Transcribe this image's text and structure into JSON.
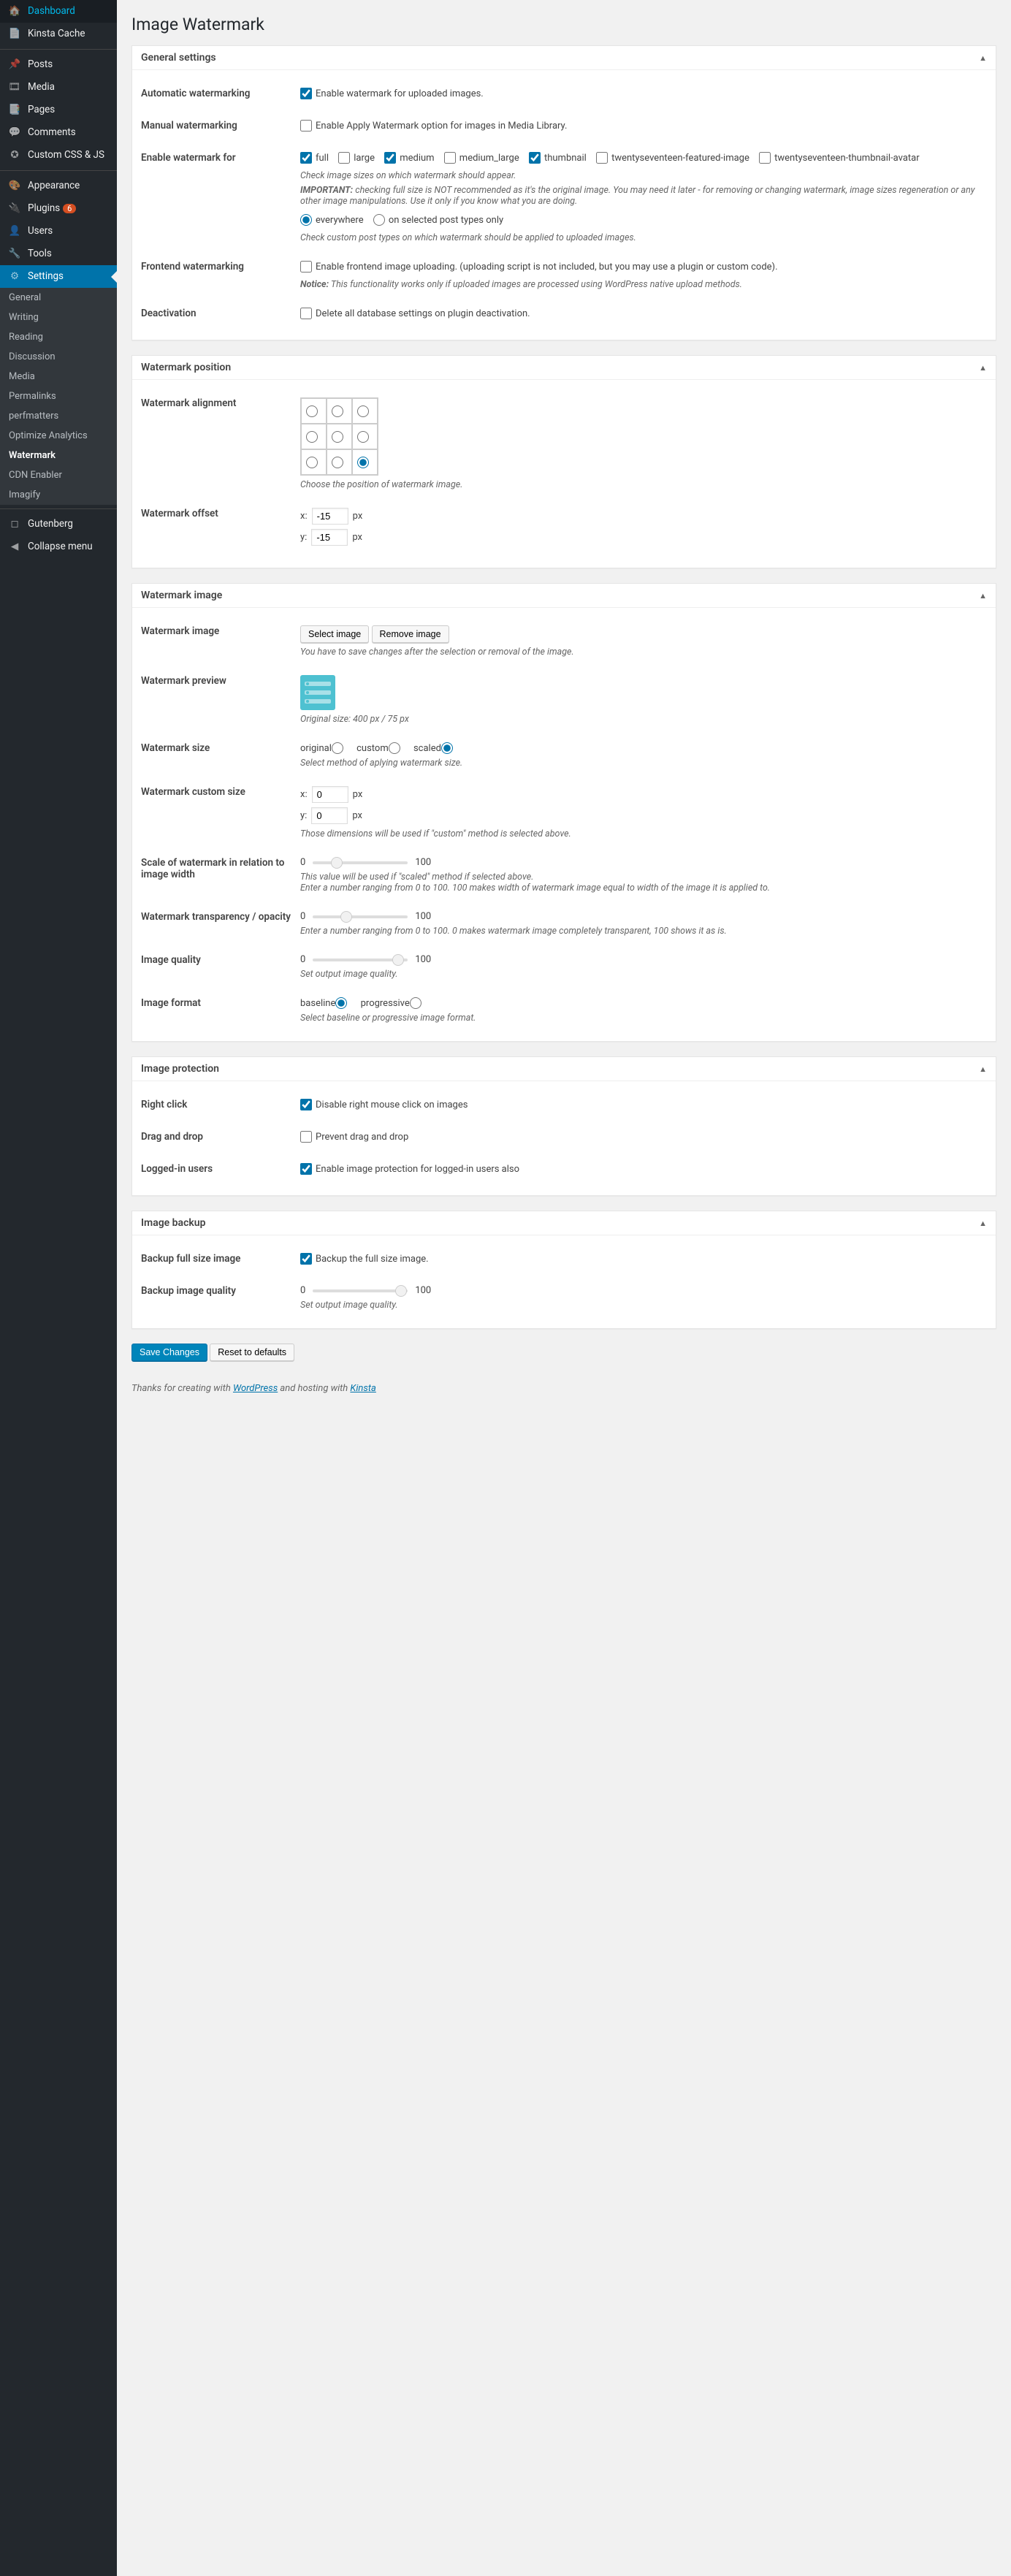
{
  "page_title": "Image Watermark",
  "sidebar": {
    "items": [
      {
        "icon": "🏠",
        "label": "Dashboard"
      },
      {
        "icon": "📄",
        "label": "Kinsta Cache"
      },
      {
        "icon": "📌",
        "label": "Posts"
      },
      {
        "icon": "🎞",
        "label": "Media"
      },
      {
        "icon": "📑",
        "label": "Pages"
      },
      {
        "icon": "💬",
        "label": "Comments"
      },
      {
        "icon": "✪",
        "label": "Custom CSS & JS"
      },
      {
        "icon": "🎨",
        "label": "Appearance"
      },
      {
        "icon": "🔌",
        "label": "Plugins",
        "badge": "6"
      },
      {
        "icon": "👤",
        "label": "Users"
      },
      {
        "icon": "🔧",
        "label": "Tools"
      },
      {
        "icon": "⚙",
        "label": "Settings",
        "active": true
      }
    ],
    "sub": [
      "General",
      "Writing",
      "Reading",
      "Discussion",
      "Media",
      "Permalinks",
      "perfmatters",
      "Optimize Analytics",
      "Watermark",
      "CDN Enabler",
      "Imagify"
    ],
    "sub_active": "Watermark",
    "tail": [
      {
        "icon": "◻",
        "label": "Gutenberg"
      },
      {
        "icon": "◀",
        "label": "Collapse menu"
      }
    ]
  },
  "general": {
    "heading": "General settings",
    "auto": {
      "label": "Automatic watermarking",
      "text": "Enable watermark for uploaded images."
    },
    "manual": {
      "label": "Manual watermarking",
      "text": "Enable Apply Watermark option for images in Media Library."
    },
    "enable_for": {
      "label": "Enable watermark for",
      "opts": [
        "full",
        "large",
        "medium",
        "medium_large",
        "thumbnail",
        "twentyseventeen-featured-image",
        "twentyseventeen-thumbnail-avatar"
      ],
      "checked": [
        "full",
        "medium",
        "thumbnail"
      ],
      "desc1": "Check image sizes on which watermark should appear.",
      "desc2": "IMPORTANT: checking full size is NOT recommended as it's the original image. You may need it later - for removing or changing watermark, image sizes regeneration or any other image manipulations. Use it only if you know what you are doing.",
      "radio": [
        "everywhere",
        "on selected post types only"
      ],
      "desc3": "Check custom post types on which watermark should be applied to uploaded images."
    },
    "frontend": {
      "label": "Frontend watermarking",
      "text": "Enable frontend image uploading. (uploading script is not included, but you may use a plugin or custom code).",
      "desc": "Notice: This functionality works only if uploaded images are processed using WordPress native upload methods."
    },
    "deact": {
      "label": "Deactivation",
      "text": "Delete all database settings on plugin deactivation."
    }
  },
  "position": {
    "heading": "Watermark position",
    "align": {
      "label": "Watermark alignment",
      "desc": "Choose the position of watermark image."
    },
    "offset": {
      "label": "Watermark offset",
      "x": "-15",
      "y": "-15",
      "unit": "px"
    }
  },
  "image": {
    "heading": "Watermark image",
    "img": {
      "label": "Watermark image",
      "select": "Select image",
      "remove": "Remove image",
      "desc": "You have to save changes after the selection or removal of the image."
    },
    "preview": {
      "label": "Watermark preview",
      "desc": "Original size: 400 px / 75 px"
    },
    "size": {
      "label": "Watermark size",
      "opts": [
        "original",
        "custom",
        "scaled"
      ],
      "desc": "Select method of aplying watermark size."
    },
    "custom": {
      "label": "Watermark custom size",
      "x": "0",
      "y": "0",
      "unit": "px",
      "desc": "Those dimensions will be used if \"custom\" method is selected above."
    },
    "scale": {
      "label": "Scale of watermark in relation to image width",
      "min": "0",
      "max": "100",
      "val": 25,
      "desc": "This value will be used if \"scaled\" method if selected above.\nEnter a number ranging from 0 to 100. 100 makes width of watermark image equal to width of the image it is applied to."
    },
    "opacity": {
      "label": "Watermark transparency / opacity",
      "min": "0",
      "max": "100",
      "val": 35,
      "desc": "Enter a number ranging from 0 to 100. 0 makes watermark image completely transparent, 100 shows it as is."
    },
    "quality": {
      "label": "Image quality",
      "min": "0",
      "max": "100",
      "val": 90,
      "desc": "Set output image quality."
    },
    "format": {
      "label": "Image format",
      "opts": [
        "baseline",
        "progressive"
      ],
      "desc": "Select baseline or progressive image format."
    }
  },
  "protect": {
    "heading": "Image protection",
    "right": {
      "label": "Right click",
      "text": "Disable right mouse click on images"
    },
    "drag": {
      "label": "Drag and drop",
      "text": "Prevent drag and drop"
    },
    "logged": {
      "label": "Logged-in users",
      "text": "Enable image protection for logged-in users also"
    }
  },
  "backup": {
    "heading": "Image backup",
    "full": {
      "label": "Backup full size image",
      "text": "Backup the full size image."
    },
    "quality": {
      "label": "Backup image quality",
      "min": "0",
      "max": "100",
      "val": 93,
      "desc": "Set output image quality."
    }
  },
  "actions": {
    "save": "Save Changes",
    "reset": "Reset to defaults"
  },
  "footer": {
    "pre": "Thanks for creating with ",
    "wp": "WordPress",
    "mid": " and hosting with ",
    "kinsta": "Kinsta"
  }
}
